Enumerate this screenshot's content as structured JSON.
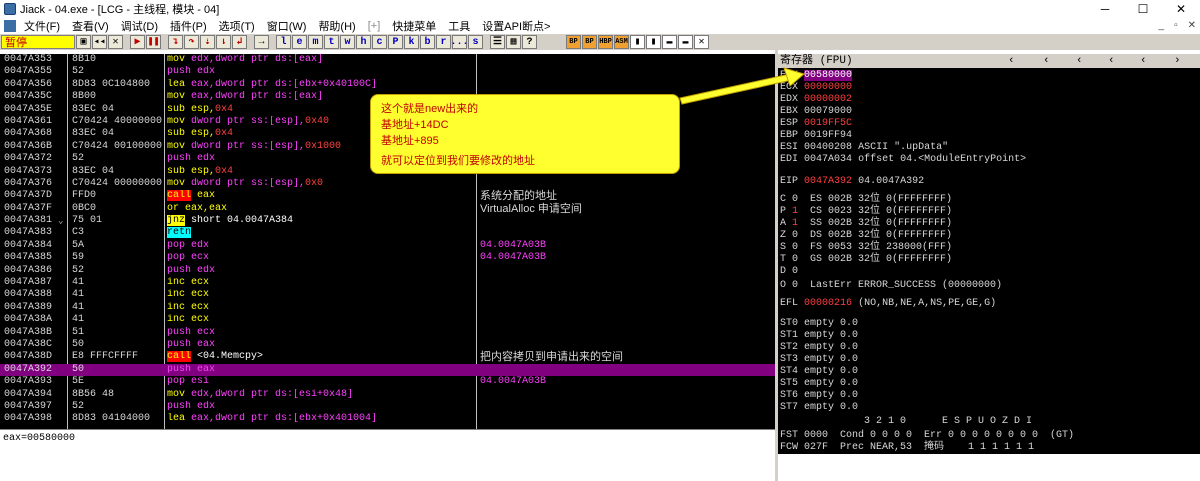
{
  "window": {
    "title": "Jiack - 04.exe - [LCG - 主线程, 模块 - 04]",
    "minimize": "─",
    "maximize": "☐",
    "close": "✕"
  },
  "menu": {
    "items": [
      "文件(F)",
      "查看(V)",
      "调试(D)",
      "插件(P)",
      "选项(T)",
      "窗口(W)",
      "帮助(H)",
      "[+]",
      "快捷菜单",
      "工具",
      "设置API断点>"
    ],
    "mdi": [
      "_",
      "▫",
      "✕"
    ]
  },
  "toolbar": {
    "status": "暂停",
    "letters": [
      "l",
      "e",
      "m",
      "t",
      "w",
      "h",
      "c",
      "P",
      "k",
      "b",
      "r",
      "...",
      "s"
    ],
    "plugins": [
      "BP",
      "BP",
      "HBP",
      "ASM"
    ]
  },
  "disasm": [
    {
      "addr": "0047A353",
      "hex": "8B10",
      "asm": [
        [
          "mov ",
          "y"
        ],
        [
          "edx,dword ptr ds:[eax]",
          "m"
        ]
      ],
      "cmt": ""
    },
    {
      "addr": "0047A355",
      "hex": "52",
      "asm": [
        [
          "push edx",
          "m"
        ]
      ],
      "cmt": ""
    },
    {
      "addr": "0047A356",
      "hex": "8D83 0C104800",
      "asm": [
        [
          "lea ",
          "y"
        ],
        [
          "eax,dword ptr ds:[ebx+0x40100C]",
          "m"
        ]
      ],
      "cmt": ""
    },
    {
      "addr": "0047A35C",
      "hex": "8B00",
      "asm": [
        [
          "mov ",
          "y"
        ],
        [
          "eax,dword ptr ds:[eax]",
          "m"
        ]
      ],
      "cmt": ""
    },
    {
      "addr": "0047A35E",
      "hex": "83EC 04",
      "asm": [
        [
          "sub esp,",
          "y"
        ],
        [
          "0x4",
          "r"
        ]
      ],
      "cmt": ""
    },
    {
      "addr": "0047A361",
      "hex": "C70424 40000000",
      "asm": [
        [
          "mov ",
          "y"
        ],
        [
          "dword ptr ss:[esp],",
          "m"
        ],
        [
          "0x40",
          "r"
        ]
      ],
      "cmt": ""
    },
    {
      "addr": "0047A368",
      "hex": "83EC 04",
      "asm": [
        [
          "sub esp,",
          "y"
        ],
        [
          "0x4",
          "r"
        ]
      ],
      "cmt": ""
    },
    {
      "addr": "0047A36B",
      "hex": "C70424 00100000",
      "asm": [
        [
          "mov ",
          "y"
        ],
        [
          "dword ptr ss:[esp],",
          "m"
        ],
        [
          "0x1000",
          "r"
        ]
      ],
      "cmt": ""
    },
    {
      "addr": "0047A372",
      "hex": "52",
      "asm": [
        [
          "push edx",
          "m"
        ]
      ],
      "cmt": ""
    },
    {
      "addr": "0047A373",
      "hex": "83EC 04",
      "asm": [
        [
          "sub esp,",
          "y"
        ],
        [
          "0x4",
          "r"
        ]
      ],
      "cmt": ""
    },
    {
      "addr": "0047A376",
      "hex": "C70424 00000000",
      "asm": [
        [
          "mov ",
          "y"
        ],
        [
          "dword ptr ss:[esp],",
          "m"
        ],
        [
          "0x0",
          "r"
        ]
      ],
      "cmt": ""
    },
    {
      "addr": "0047A37D",
      "hex": "FFD0",
      "asm": [
        [
          "call",
          "call"
        ],
        [
          " eax",
          "y"
        ]
      ],
      "cmt": "系统分配的地址"
    },
    {
      "addr": "0047A37F",
      "hex": "0BC0",
      "asm": [
        [
          "or eax,eax",
          "y"
        ]
      ],
      "cmt": "VirtualAlloc 申请空间"
    },
    {
      "addr": "0047A381",
      "hex": "75 01",
      "fold": "⌄",
      "asm": [
        [
          "jnz",
          "jmp"
        ],
        [
          " short 04.0047A384",
          "w"
        ]
      ],
      "cmt": ""
    },
    {
      "addr": "0047A383",
      "hex": "C3",
      "asm": [
        [
          "retn",
          "retn"
        ]
      ],
      "cmt": ""
    },
    {
      "addr": "0047A384",
      "hex": "5A",
      "asm": [
        [
          "pop edx",
          "m"
        ]
      ],
      "cmt": "04.0047A03B",
      "mono": true
    },
    {
      "addr": "0047A385",
      "hex": "59",
      "asm": [
        [
          "pop ecx",
          "m"
        ]
      ],
      "cmt": "04.0047A03B",
      "mono": true
    },
    {
      "addr": "0047A386",
      "hex": "52",
      "asm": [
        [
          "push edx",
          "m"
        ]
      ],
      "cmt": ""
    },
    {
      "addr": "0047A387",
      "hex": "41",
      "asm": [
        [
          "inc ecx",
          "y"
        ]
      ],
      "cmt": ""
    },
    {
      "addr": "0047A388",
      "hex": "41",
      "asm": [
        [
          "inc ecx",
          "y"
        ]
      ],
      "cmt": ""
    },
    {
      "addr": "0047A389",
      "hex": "41",
      "asm": [
        [
          "inc ecx",
          "y"
        ]
      ],
      "cmt": ""
    },
    {
      "addr": "0047A38A",
      "hex": "41",
      "asm": [
        [
          "inc ecx",
          "y"
        ]
      ],
      "cmt": ""
    },
    {
      "addr": "0047A38B",
      "hex": "51",
      "asm": [
        [
          "push ecx",
          "m"
        ]
      ],
      "cmt": ""
    },
    {
      "addr": "0047A38C",
      "hex": "50",
      "asm": [
        [
          "push eax",
          "m"
        ]
      ],
      "cmt": ""
    },
    {
      "addr": "0047A38D",
      "hex": "E8 FFFCFFFF",
      "asm": [
        [
          "call",
          "call"
        ],
        [
          " <04.Memcpy>",
          "w"
        ]
      ],
      "cmt": "把内容拷贝到申请出来的空间"
    },
    {
      "addr": "0047A392",
      "hex": "50",
      "asm": [
        [
          "push eax",
          "m"
        ]
      ],
      "cmt": "",
      "sel": true
    },
    {
      "addr": "0047A393",
      "hex": "5E",
      "asm": [
        [
          "pop esi",
          "m"
        ]
      ],
      "cmt": "04.0047A03B",
      "mono": true
    },
    {
      "addr": "0047A394",
      "hex": "8B56 48",
      "asm": [
        [
          "mov ",
          "y"
        ],
        [
          "edx,dword ptr ds:[esi+0x48]",
          "m"
        ]
      ],
      "cmt": ""
    },
    {
      "addr": "0047A397",
      "hex": "52",
      "asm": [
        [
          "push edx",
          "m"
        ]
      ],
      "cmt": ""
    },
    {
      "addr": "0047A398",
      "hex": "8D83 04104000",
      "asm": [
        [
          "lea ",
          "y"
        ],
        [
          "eax,dword ptr ds:[ebx+0x401004]",
          "m"
        ]
      ],
      "cmt": ""
    }
  ],
  "registers": {
    "header": "寄存器 (FPU)",
    "eax": {
      "name": "EAX",
      "val": "00580000"
    },
    "ecx": {
      "name": "ECX",
      "val": "00000000"
    },
    "edx": {
      "name": "EDX",
      "val": "00000002"
    },
    "ebx": {
      "name": "EBX",
      "val": "00079000"
    },
    "esp": {
      "name": "ESP",
      "val": "0019FF5C"
    },
    "ebp": {
      "name": "EBP",
      "val": "0019FF94"
    },
    "esi": {
      "name": "ESI",
      "val": "00400208",
      "extra": "ASCII \".upData\""
    },
    "edi": {
      "name": "EDI",
      "val": "0047A034",
      "extra": "offset 04.<ModuleEntryPoint>"
    },
    "eip": {
      "name": "EIP",
      "val": "0047A392",
      "extra": "04.0047A392"
    },
    "flags": [
      "C 0  ES 002B 32位 0(FFFFFFFF)",
      "P 1  CS 0023 32位 0(FFFFFFFF)",
      "A 1  SS 002B 32位 0(FFFFFFFF)",
      "Z 0  DS 002B 32位 0(FFFFFFFF)",
      "S 0  FS 0053 32位 238000(FFF)",
      "T 0  GS 002B 32位 0(FFFFFFFF)",
      "D 0",
      "O 0  LastErr ERROR_SUCCESS (00000000)"
    ],
    "efl": {
      "name": "EFL",
      "val": "00000216",
      "extra": "(NO,NB,NE,A,NS,PE,GE,G)"
    },
    "st": [
      "ST0 empty 0.0",
      "ST1 empty 0.0",
      "ST2 empty 0.0",
      "ST3 empty 0.0",
      "ST4 empty 0.0",
      "ST5 empty 0.0",
      "ST6 empty 0.0",
      "ST7 empty 0.0"
    ],
    "fpu_hdr": "              3 2 1 0      E S P U O Z D I",
    "fst": "FST 0000  Cond 0 0 0 0  Err 0 0 0 0 0 0 0 0  (GT)",
    "fcw": "FCW 027F  Prec NEAR,53  掩码    1 1 1 1 1 1"
  },
  "info": "eax=00580000",
  "note": {
    "line1": "这个就是new出来的",
    "line2": "基地址+14DC",
    "line3": "基地址+895",
    "line4": "就可以定位到我们要修改的地址"
  }
}
